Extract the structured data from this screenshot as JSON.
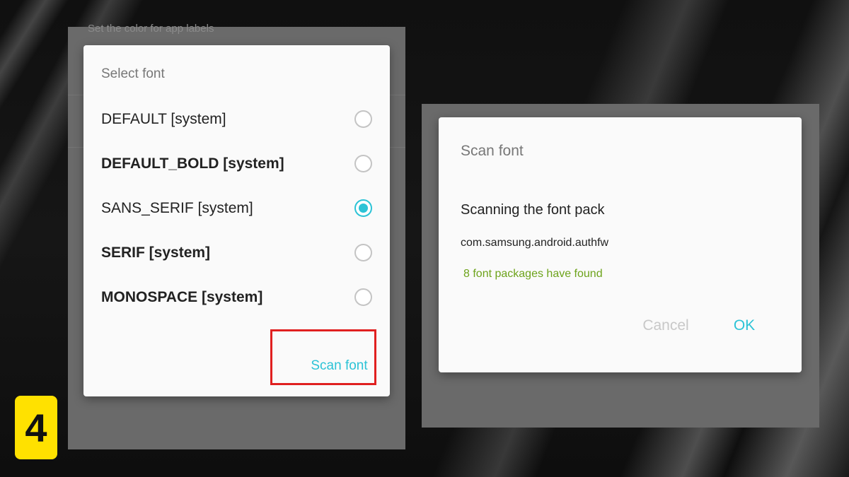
{
  "step_number": "4",
  "left_screen": {
    "background_hint_text": "Set the color for app labels",
    "select_font_dialog": {
      "title": "Select font",
      "options": [
        {
          "label": "DEFAULT [system]",
          "bold": false,
          "selected": false
        },
        {
          "label": "DEFAULT_BOLD [system]",
          "bold": true,
          "selected": false
        },
        {
          "label": "SANS_SERIF [system]",
          "bold": false,
          "selected": true
        },
        {
          "label": "SERIF [system]",
          "bold": true,
          "selected": false
        },
        {
          "label": "MONOSPACE [system]",
          "bold": true,
          "selected": false
        }
      ],
      "scan_button_label": "Scan font",
      "highlight_color": "#e02020"
    }
  },
  "right_screen": {
    "scan_font_dialog": {
      "title": "Scan font",
      "message": "Scanning the font pack",
      "package_name": "com.samsung.android.authfw",
      "result_text": "8 font packages have found",
      "cancel_label": "Cancel",
      "ok_label": "OK"
    }
  },
  "colors": {
    "accent": "#2cc3d6",
    "success": "#6da31b",
    "badge": "#ffe100"
  }
}
